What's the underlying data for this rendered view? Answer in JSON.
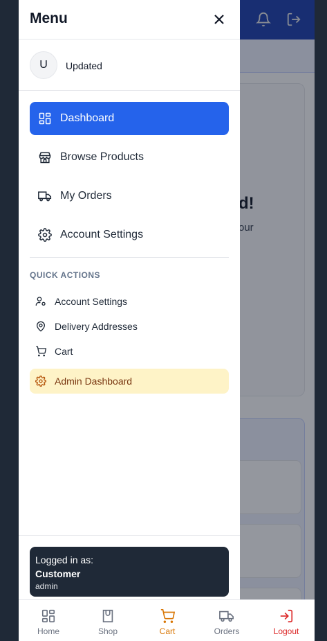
{
  "drawer": {
    "title": "Menu",
    "user": {
      "initial": "U",
      "name": "Updated"
    },
    "main_nav": [
      {
        "label": "Dashboard",
        "icon": "grid-icon",
        "active": true
      },
      {
        "label": "Browse Products",
        "icon": "store-icon",
        "active": false
      },
      {
        "label": "My Orders",
        "icon": "truck-icon",
        "active": false
      },
      {
        "label": "Account Settings",
        "icon": "gear-icon",
        "active": false
      }
    ],
    "quick_actions": {
      "heading": "QUICK ACTIONS",
      "items": [
        {
          "label": "Account Settings",
          "icon": "user-gear-icon"
        },
        {
          "label": "Delivery Addresses",
          "icon": "map-pin-icon"
        },
        {
          "label": "Cart",
          "icon": "cart-icon"
        }
      ],
      "admin": {
        "label": "Admin Dashboard",
        "icon": "gear-icon"
      }
    },
    "footer": {
      "label": "Logged in as:",
      "role": "Customer",
      "username": "admin"
    }
  },
  "background_page": {
    "hero_text": "d!",
    "hero_sub": "our"
  },
  "bottom_nav": [
    {
      "label": "Home",
      "icon": "grid-icon"
    },
    {
      "label": "Shop",
      "icon": "shopping-bag-icon"
    },
    {
      "label": "Cart",
      "icon": "cart-icon",
      "active": true
    },
    {
      "label": "Orders",
      "icon": "truck-icon"
    },
    {
      "label": "Logout",
      "icon": "logout-icon"
    }
  ],
  "colors": {
    "accent": "#2563eb",
    "header_blue": "#1e40af",
    "admin_bg": "#fef3c7",
    "footer_card": "#1f2937",
    "cart_active": "#d97706",
    "logout": "#dc2626"
  }
}
